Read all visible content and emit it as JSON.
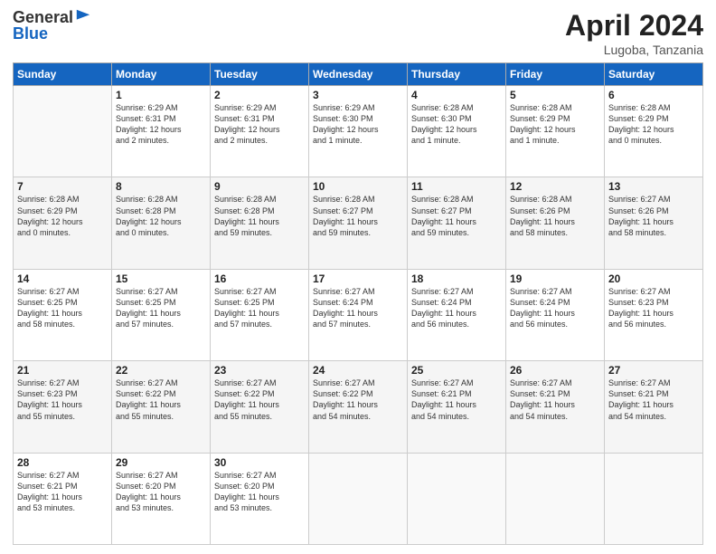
{
  "header": {
    "logo_general": "General",
    "logo_blue": "Blue",
    "title": "April 2024",
    "location": "Lugoba, Tanzania"
  },
  "columns": [
    "Sunday",
    "Monday",
    "Tuesday",
    "Wednesday",
    "Thursday",
    "Friday",
    "Saturday"
  ],
  "weeks": [
    [
      {
        "day": "",
        "info": ""
      },
      {
        "day": "1",
        "info": "Sunrise: 6:29 AM\nSunset: 6:31 PM\nDaylight: 12 hours\nand 2 minutes."
      },
      {
        "day": "2",
        "info": "Sunrise: 6:29 AM\nSunset: 6:31 PM\nDaylight: 12 hours\nand 2 minutes."
      },
      {
        "day": "3",
        "info": "Sunrise: 6:29 AM\nSunset: 6:30 PM\nDaylight: 12 hours\nand 1 minute."
      },
      {
        "day": "4",
        "info": "Sunrise: 6:28 AM\nSunset: 6:30 PM\nDaylight: 12 hours\nand 1 minute."
      },
      {
        "day": "5",
        "info": "Sunrise: 6:28 AM\nSunset: 6:29 PM\nDaylight: 12 hours\nand 1 minute."
      },
      {
        "day": "6",
        "info": "Sunrise: 6:28 AM\nSunset: 6:29 PM\nDaylight: 12 hours\nand 0 minutes."
      }
    ],
    [
      {
        "day": "7",
        "info": "Sunrise: 6:28 AM\nSunset: 6:29 PM\nDaylight: 12 hours\nand 0 minutes."
      },
      {
        "day": "8",
        "info": "Sunrise: 6:28 AM\nSunset: 6:28 PM\nDaylight: 12 hours\nand 0 minutes."
      },
      {
        "day": "9",
        "info": "Sunrise: 6:28 AM\nSunset: 6:28 PM\nDaylight: 11 hours\nand 59 minutes."
      },
      {
        "day": "10",
        "info": "Sunrise: 6:28 AM\nSunset: 6:27 PM\nDaylight: 11 hours\nand 59 minutes."
      },
      {
        "day": "11",
        "info": "Sunrise: 6:28 AM\nSunset: 6:27 PM\nDaylight: 11 hours\nand 59 minutes."
      },
      {
        "day": "12",
        "info": "Sunrise: 6:28 AM\nSunset: 6:26 PM\nDaylight: 11 hours\nand 58 minutes."
      },
      {
        "day": "13",
        "info": "Sunrise: 6:27 AM\nSunset: 6:26 PM\nDaylight: 11 hours\nand 58 minutes."
      }
    ],
    [
      {
        "day": "14",
        "info": "Sunrise: 6:27 AM\nSunset: 6:25 PM\nDaylight: 11 hours\nand 58 minutes."
      },
      {
        "day": "15",
        "info": "Sunrise: 6:27 AM\nSunset: 6:25 PM\nDaylight: 11 hours\nand 57 minutes."
      },
      {
        "day": "16",
        "info": "Sunrise: 6:27 AM\nSunset: 6:25 PM\nDaylight: 11 hours\nand 57 minutes."
      },
      {
        "day": "17",
        "info": "Sunrise: 6:27 AM\nSunset: 6:24 PM\nDaylight: 11 hours\nand 57 minutes."
      },
      {
        "day": "18",
        "info": "Sunrise: 6:27 AM\nSunset: 6:24 PM\nDaylight: 11 hours\nand 56 minutes."
      },
      {
        "day": "19",
        "info": "Sunrise: 6:27 AM\nSunset: 6:24 PM\nDaylight: 11 hours\nand 56 minutes."
      },
      {
        "day": "20",
        "info": "Sunrise: 6:27 AM\nSunset: 6:23 PM\nDaylight: 11 hours\nand 56 minutes."
      }
    ],
    [
      {
        "day": "21",
        "info": "Sunrise: 6:27 AM\nSunset: 6:23 PM\nDaylight: 11 hours\nand 55 minutes."
      },
      {
        "day": "22",
        "info": "Sunrise: 6:27 AM\nSunset: 6:22 PM\nDaylight: 11 hours\nand 55 minutes."
      },
      {
        "day": "23",
        "info": "Sunrise: 6:27 AM\nSunset: 6:22 PM\nDaylight: 11 hours\nand 55 minutes."
      },
      {
        "day": "24",
        "info": "Sunrise: 6:27 AM\nSunset: 6:22 PM\nDaylight: 11 hours\nand 54 minutes."
      },
      {
        "day": "25",
        "info": "Sunrise: 6:27 AM\nSunset: 6:21 PM\nDaylight: 11 hours\nand 54 minutes."
      },
      {
        "day": "26",
        "info": "Sunrise: 6:27 AM\nSunset: 6:21 PM\nDaylight: 11 hours\nand 54 minutes."
      },
      {
        "day": "27",
        "info": "Sunrise: 6:27 AM\nSunset: 6:21 PM\nDaylight: 11 hours\nand 54 minutes."
      }
    ],
    [
      {
        "day": "28",
        "info": "Sunrise: 6:27 AM\nSunset: 6:21 PM\nDaylight: 11 hours\nand 53 minutes."
      },
      {
        "day": "29",
        "info": "Sunrise: 6:27 AM\nSunset: 6:20 PM\nDaylight: 11 hours\nand 53 minutes."
      },
      {
        "day": "30",
        "info": "Sunrise: 6:27 AM\nSunset: 6:20 PM\nDaylight: 11 hours\nand 53 minutes."
      },
      {
        "day": "",
        "info": ""
      },
      {
        "day": "",
        "info": ""
      },
      {
        "day": "",
        "info": ""
      },
      {
        "day": "",
        "info": ""
      }
    ]
  ]
}
